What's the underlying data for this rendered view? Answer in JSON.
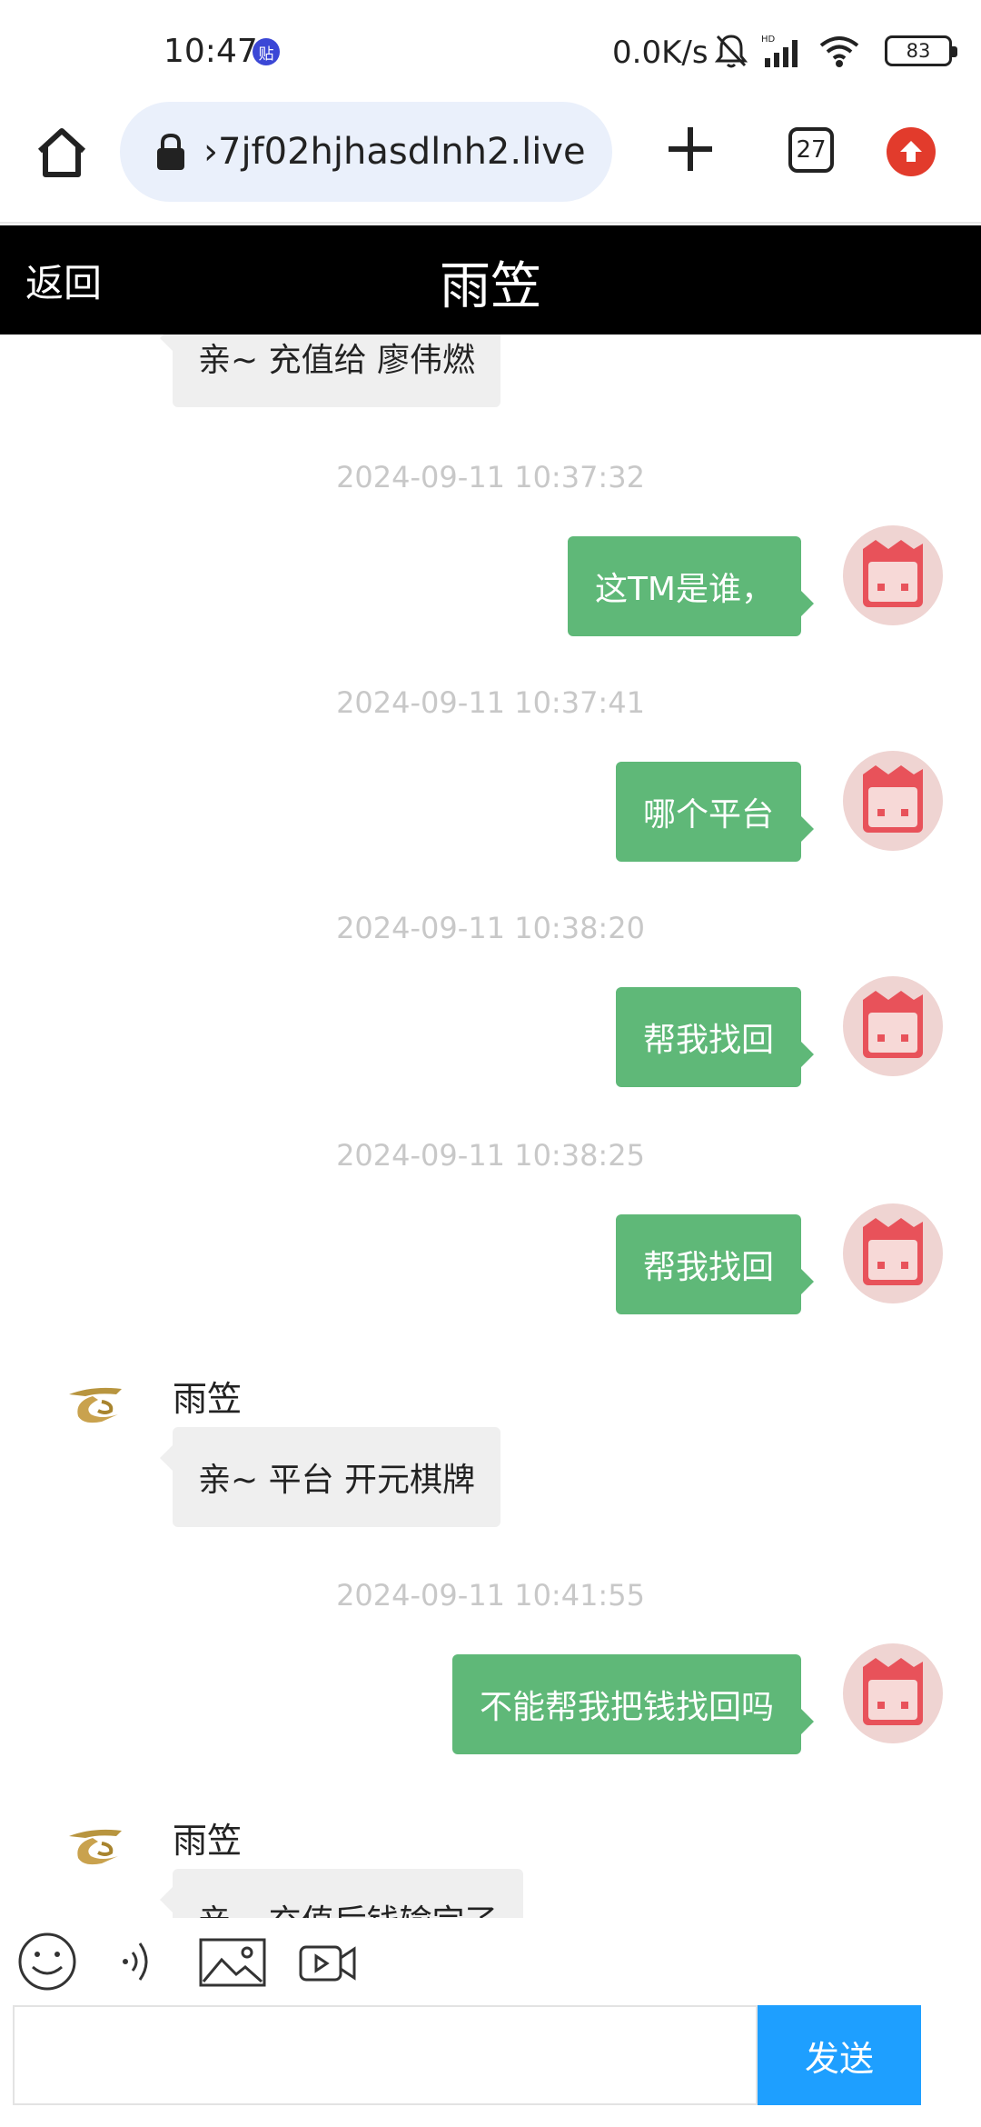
{
  "status_bar": {
    "time": "10:47",
    "notification_badge": "贴",
    "network_speed": "0.0K/s",
    "battery": "83",
    "icons": [
      "bell-off-icon",
      "signal-icon",
      "wifi-icon",
      "battery-icon"
    ]
  },
  "browser": {
    "url": "›7jf02hjhasdlnh2.live",
    "tab_count": "27",
    "icons": [
      "home-icon",
      "lock-icon",
      "plus-icon",
      "tabs-icon",
      "update-icon"
    ]
  },
  "header": {
    "back_label": "返回",
    "title": "雨笠"
  },
  "messages": [
    {
      "type": "in",
      "text": "亲~ 充值给 廖伟燃"
    },
    {
      "type": "timestamp",
      "text": "2024-09-11 10:37:32"
    },
    {
      "type": "out",
      "text": "这TM是谁，"
    },
    {
      "type": "timestamp",
      "text": "2024-09-11 10:37:41"
    },
    {
      "type": "out",
      "text": "哪个平台"
    },
    {
      "type": "timestamp",
      "text": "2024-09-11 10:38:20"
    },
    {
      "type": "out",
      "text": "帮我找回"
    },
    {
      "type": "timestamp",
      "text": "2024-09-11 10:38:25"
    },
    {
      "type": "out",
      "text": "帮我找回"
    },
    {
      "type": "in",
      "sender": "雨笠",
      "text": "亲~ 平台 开元棋牌"
    },
    {
      "type": "timestamp",
      "text": "2024-09-11 10:41:55"
    },
    {
      "type": "out",
      "text": "不能帮我把钱找回吗"
    },
    {
      "type": "in",
      "sender": "雨笠",
      "text": "亲~ 充值后钱输完了"
    }
  ],
  "input": {
    "value": "",
    "send_label": "发送",
    "tools": [
      "emoji-icon",
      "voice-icon",
      "image-icon",
      "video-icon"
    ]
  },
  "colors": {
    "outgoing_bubble": "#5fb878",
    "incoming_bubble": "#efefef",
    "send_button": "#1e9fff",
    "header_bg": "#000000",
    "avatar_me": "#e8525a"
  }
}
